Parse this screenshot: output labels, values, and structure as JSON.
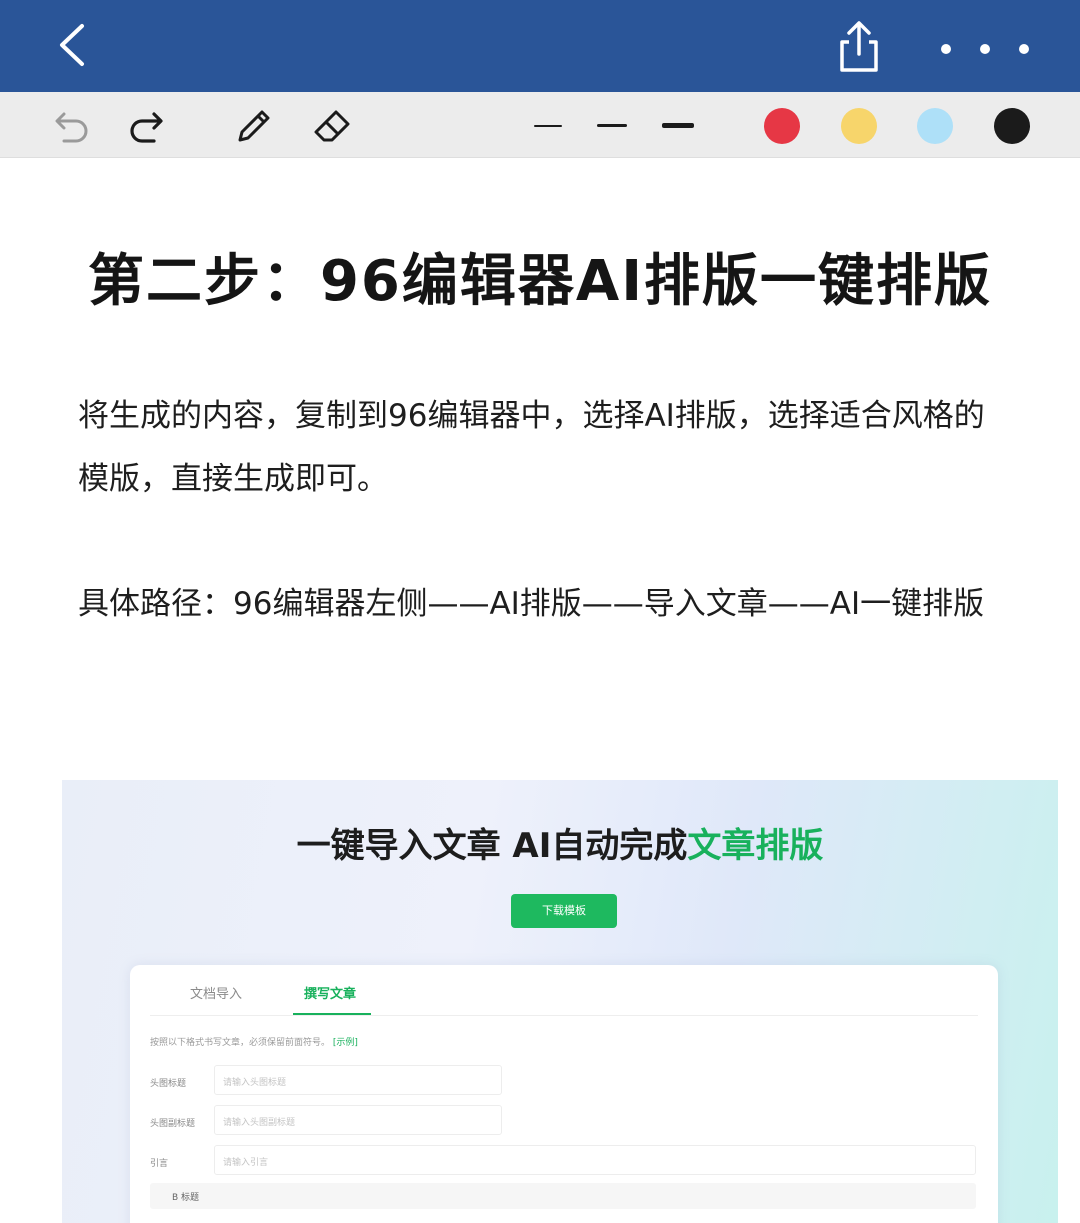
{
  "topbar": {
    "back_icon": "chevron-left-icon",
    "share_icon": "share-icon",
    "more_icon": "more-dots-icon"
  },
  "toolbar": {
    "tools": [
      "undo-icon",
      "redo-icon",
      "pencil-icon",
      "eraser-icon"
    ],
    "stroke_widths": [
      "thin",
      "medium",
      "thick"
    ],
    "colors": [
      "#e63745",
      "#f7d56b",
      "#aee0f8",
      "#1b1b1b"
    ]
  },
  "document": {
    "title": "第二步：96编辑器AI排版一键排版",
    "paragraph1": "将生成的内容，复制到96编辑器中，选择AI排版，选择适合风格的模版，直接生成即可。",
    "paragraph2": "具体路径：96编辑器左侧——AI排版——导入文章——AI一键排版"
  },
  "screenshot": {
    "heading_main": "一键导入文章 AI自动完成",
    "heading_highlight": "文章排版",
    "download_button": "下载模板",
    "tabs": [
      "文档导入",
      "撰写文章"
    ],
    "hint": "按照以下格式书写文章，必须保留前面符号。",
    "hint_example": "[示例]",
    "fields": [
      {
        "label": "头图标题",
        "placeholder": "请输入头图标题"
      },
      {
        "label": "头图副标题",
        "placeholder": "请输入头图副标题"
      },
      {
        "label": "引言",
        "placeholder": "请输入引言"
      }
    ],
    "editor_toolbar": "B  标题"
  }
}
